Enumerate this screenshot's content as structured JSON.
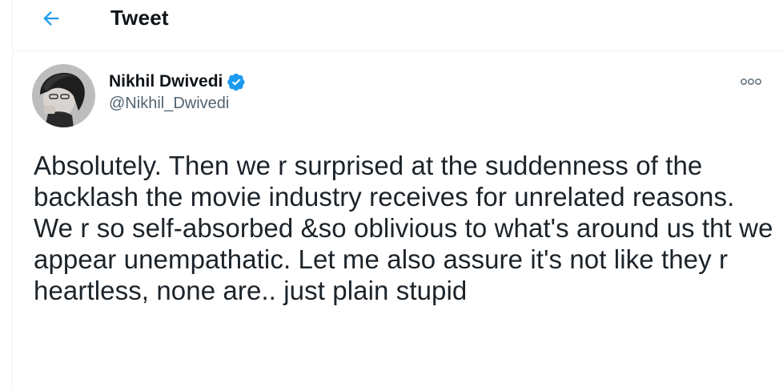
{
  "header": {
    "title": "Tweet",
    "back_icon": "back-arrow-icon"
  },
  "author": {
    "display_name": "Nikhil Dwivedi",
    "handle": "@Nikhil_Dwivedi",
    "verified": true,
    "verified_icon": "verified-badge-icon"
  },
  "tweet": {
    "text": "Absolutely. Then we r surprised at the suddenness of the backlash the movie industry receives for unrelated reasons. We r so self-absorbed &so oblivious to what's around us tht we appear unempathatic. Let me also assure it's not like they r heartless, none are.. just plain stupid"
  },
  "colors": {
    "accent": "#1d9bf0",
    "text": "#0f1419",
    "secondary_text": "#536471",
    "divider": "#eff3f4"
  },
  "icons": {
    "more": "more-options-icon"
  }
}
